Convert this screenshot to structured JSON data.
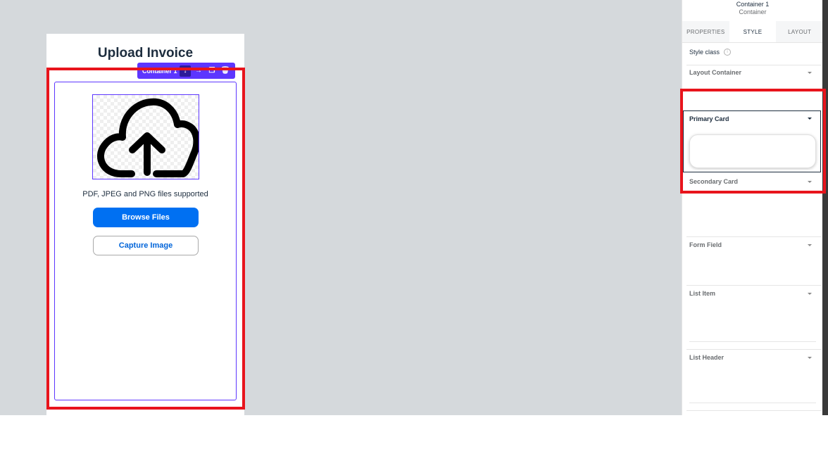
{
  "canvas": {
    "page_title": "Upload Invoice",
    "support_text": "PDF, JPEG and PNG files supported",
    "browse_button_label": "Browse Files",
    "capture_button_label": "Capture Image",
    "upload_icon": "cloud-upload-icon"
  },
  "toolbar": {
    "container_label": "Container 1",
    "icons": [
      "arrow-down-icon",
      "arrow-right-icon",
      "copy-icon",
      "delete-icon"
    ]
  },
  "panel": {
    "title": "Container 1",
    "subtitle": "Container",
    "tabs": [
      "PROPERTIES",
      "STYLE",
      "LAYOUT"
    ],
    "active_tab": "STYLE",
    "style_class_label": "Style class",
    "sections": {
      "layout_container": "Layout Container",
      "primary_card": "Primary Card",
      "secondary_card": "Secondary Card",
      "form_field": "Form Field",
      "list_item": "List Item",
      "list_header": "List Header"
    }
  },
  "colors": {
    "highlight": "#e8141c",
    "selection": "#5d36ff",
    "primary_button": "#0070f2"
  }
}
